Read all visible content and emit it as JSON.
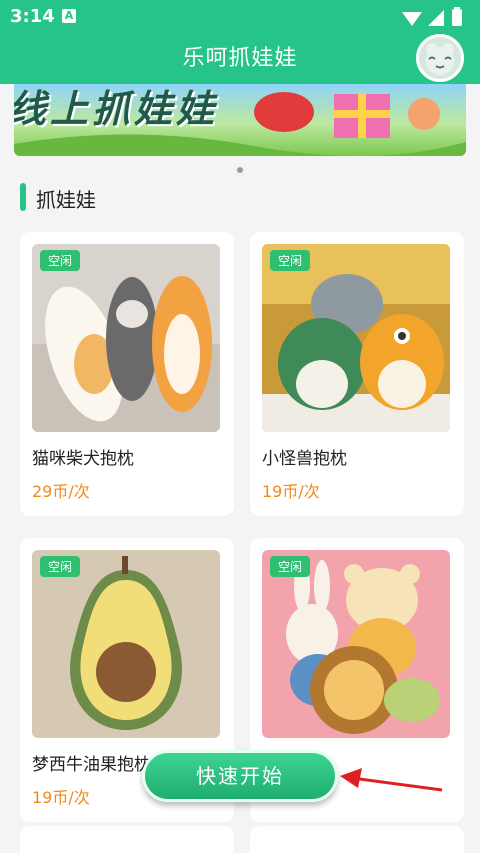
{
  "status": {
    "time": "3:14",
    "a_icon": "A"
  },
  "header": {
    "title": "乐呵抓娃娃"
  },
  "banner": {
    "text": "线上抓娃娃"
  },
  "section": {
    "title": "抓娃娃"
  },
  "products": [
    {
      "badge": "空闲",
      "name": "猫咪柴犬抱枕",
      "price": "29币/次"
    },
    {
      "badge": "空闲",
      "name": "小怪兽抱枕",
      "price": "19币/次"
    },
    {
      "badge": "空闲",
      "name": "梦西牛油果抱枕",
      "price": "19币/次"
    },
    {
      "badge": "空闲",
      "name": "",
      "price": ""
    }
  ],
  "quick_start": {
    "label": "快速开始"
  },
  "colors": {
    "primary": "#27c48a",
    "price": "#f08a1a",
    "badge": "#2fbf71"
  }
}
